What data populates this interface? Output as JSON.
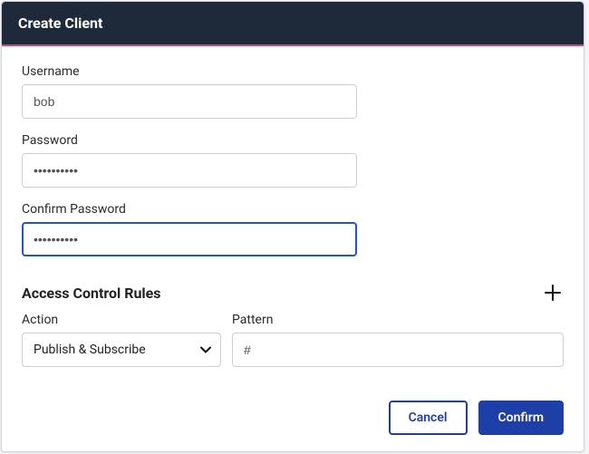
{
  "header": {
    "title": "Create Client"
  },
  "form": {
    "username": {
      "label": "Username",
      "value": "bob"
    },
    "password": {
      "label": "Password",
      "value": "••••••••••"
    },
    "confirm": {
      "label": "Confirm Password",
      "value": "••••••••••"
    }
  },
  "acl": {
    "title": "Access Control Rules",
    "action_label": "Action",
    "pattern_label": "Pattern",
    "action_value": "Publish & Subscribe",
    "pattern_value": "#"
  },
  "footer": {
    "cancel": "Cancel",
    "confirm": "Confirm"
  }
}
